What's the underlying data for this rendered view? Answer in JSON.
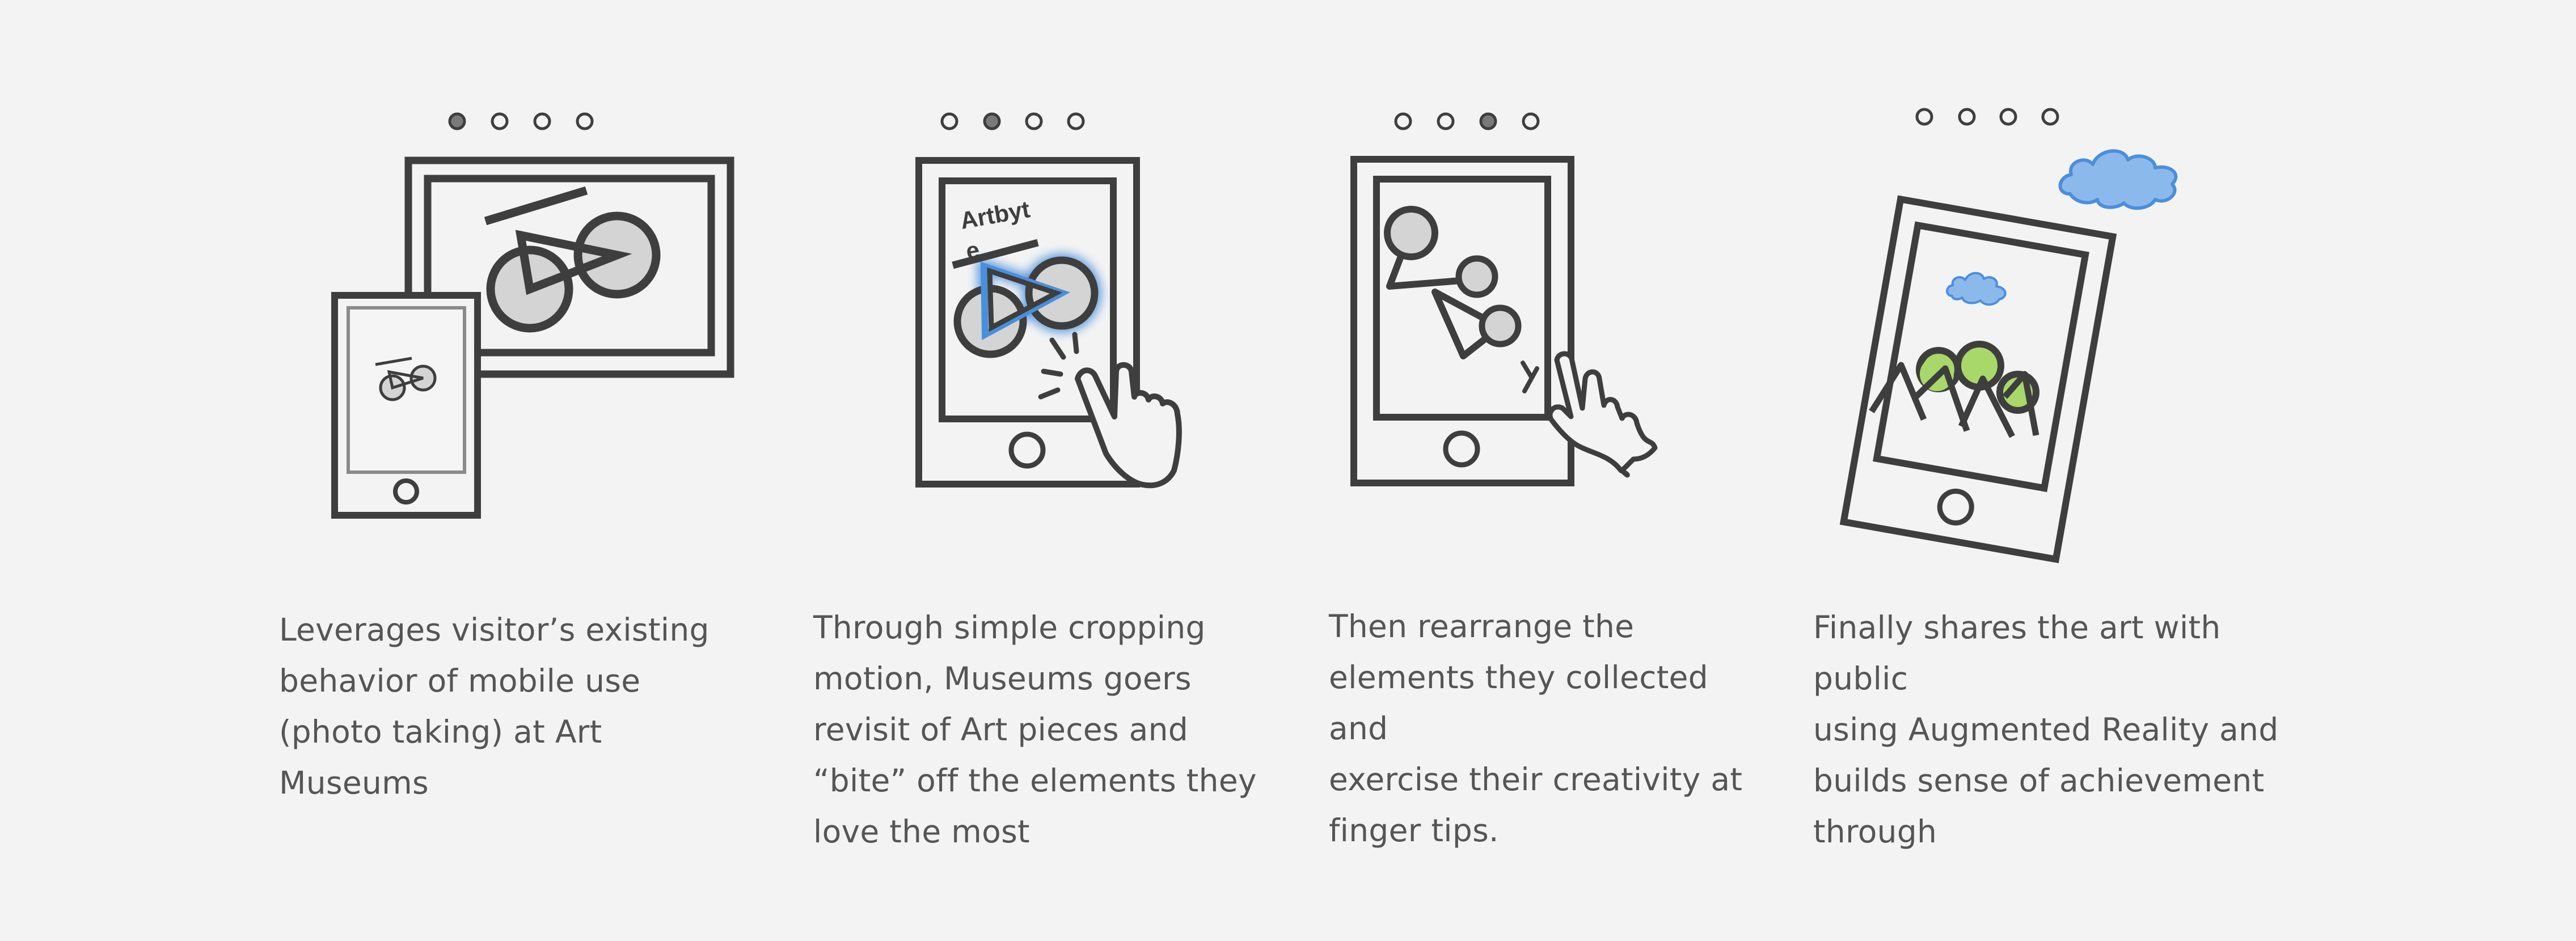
{
  "steps": [
    {
      "caption": "Leverages visitor’s existing\nbehavior of mobile use\n(photo taking) at Art\nMuseums",
      "active_dot": 0
    },
    {
      "caption": "Through simple cropping\nmotion, Museums goers\nrevisit of Art pieces and\n“bite” off the elements they\nlove the most",
      "active_dot": 1,
      "screen_text": [
        "Artbyt",
        "e"
      ]
    },
    {
      "caption": "Then rearrange the\nelements they collected and\nexercise their creativity at\nfinger tips.",
      "active_dot": 2
    },
    {
      "caption": "Finally shares the art with public\nusing Augmented Reality and\nbuilds sense of achievement\nthrough",
      "active_dot": null
    }
  ],
  "icons": {
    "step1": [
      "picture-frame-icon",
      "phone-icon",
      "bicycle-icon"
    ],
    "step2": [
      "phone-icon",
      "bicycle-icon",
      "tap-hand-icon"
    ],
    "step3": [
      "phone-icon",
      "rearranged-elements-icon",
      "pinch-hand-icon"
    ],
    "step4": [
      "phone-icon",
      "cloud-icon",
      "tree-icon"
    ]
  },
  "colors": {
    "background": "#f3f3f3",
    "ink": "#3e3e3e",
    "text": "#555555",
    "highlight_blue": "#4a8fdc",
    "cloud_blue": "#8cb9ec",
    "tree_green": "#a8d86a",
    "circle_grey": "#d4d4d4"
  }
}
